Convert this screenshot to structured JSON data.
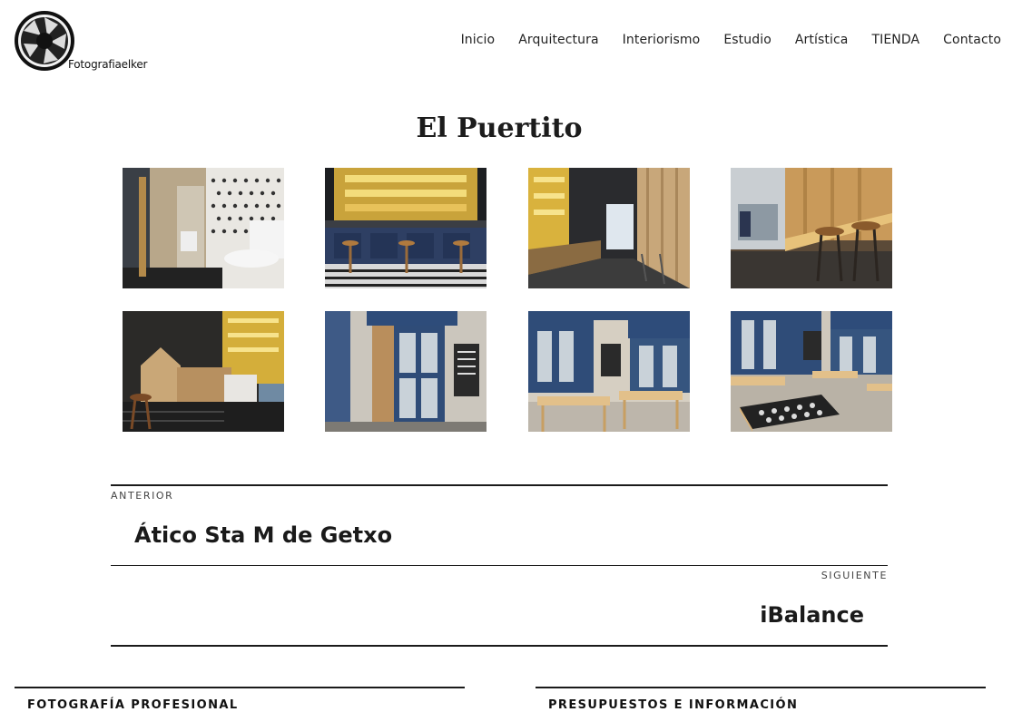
{
  "header": {
    "logo_text": "Fotografiaelker",
    "nav": [
      "Inicio",
      "Arquitectura",
      "Interiorismo",
      "Estudio",
      "Artística",
      "TIENDA",
      "Contacto"
    ]
  },
  "page": {
    "title": "El Puertito"
  },
  "gallery": {
    "images": [
      {
        "icon": "restroom-photo"
      },
      {
        "icon": "bar-counter-photo"
      },
      {
        "icon": "bar-corridor-photo"
      },
      {
        "icon": "bar-stools-photo"
      },
      {
        "icon": "bar-interior-photo"
      },
      {
        "icon": "storefront-door-photo"
      },
      {
        "icon": "terrace-photo"
      },
      {
        "icon": "terrace-tables-photo"
      }
    ]
  },
  "post_nav": {
    "previous_label": "ANTERIOR",
    "previous_title": "Ático Sta M de Getxo",
    "next_label": "SIGUIENTE",
    "next_title": "iBalance"
  },
  "footer": {
    "col1_title": "FOTOGRAFÍA PROFESIONAL",
    "col2_title": "PRESUPUESTOS E INFORMACIÓN"
  },
  "colors": {
    "text": "#1a1a1a",
    "blue_facade": "#2f4c78",
    "warm_light": "#e8c25a"
  }
}
